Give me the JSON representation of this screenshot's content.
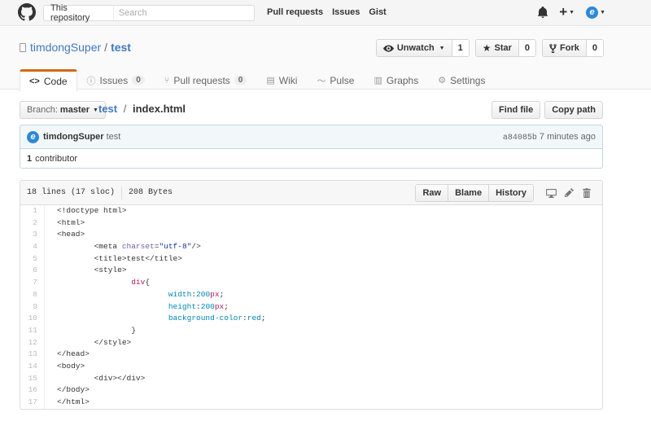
{
  "header": {
    "scope_label": "This repository",
    "search_placeholder": "Search",
    "nav": [
      "Pull requests",
      "Issues",
      "Gist"
    ],
    "icons": [
      "octocat-logo",
      "bell-icon",
      "plus-icon",
      "avatar"
    ]
  },
  "repo": {
    "owner": "timdongSuper",
    "separator": "/",
    "name": "test",
    "watch_label": "Unwatch",
    "watch_count": "1",
    "star_label": "Star",
    "star_count": "0",
    "fork_label": "Fork",
    "fork_count": "0"
  },
  "tabs": [
    {
      "label": "Code",
      "icon": "code-icon",
      "selected": true
    },
    {
      "label": "Issues",
      "icon": "issue-icon",
      "count": "0"
    },
    {
      "label": "Pull requests",
      "icon": "pr-icon",
      "count": "0"
    },
    {
      "label": "Wiki",
      "icon": "book-icon"
    },
    {
      "label": "Pulse",
      "icon": "pulse-icon"
    },
    {
      "label": "Graphs",
      "icon": "graph-icon"
    },
    {
      "label": "Settings",
      "icon": "gear-icon"
    }
  ],
  "file_nav": {
    "branch_label": "Branch:",
    "branch_name": "master",
    "crumb_repo": "test",
    "crumb_sep": "/",
    "crumb_file": "index.html",
    "find_file": "Find file",
    "copy_path": "Copy path"
  },
  "commit": {
    "author": "timdongSuper",
    "message": "test",
    "sha": "a84085b",
    "time": "7 minutes ago",
    "contributors_count": "1",
    "contributors_label": "contributor"
  },
  "file": {
    "lines_info": "18 lines (17 sloc)",
    "size": "208 Bytes",
    "raw": "Raw",
    "blame": "Blame",
    "history": "History"
  },
  "colors": {
    "link": "#4078c0",
    "tab_accent": "#d26911",
    "commit_bg": "#f2f8fa"
  }
}
